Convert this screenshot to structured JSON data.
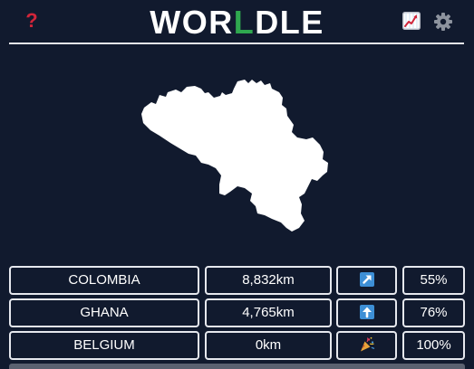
{
  "header": {
    "help_label": "?",
    "title_prefix": "WOR",
    "title_accent": "L",
    "title_suffix": "DLE"
  },
  "map": {
    "shape_icon": "belgium-silhouette",
    "fill_color": "#ffffff"
  },
  "colors": {
    "background": "#111a2e",
    "help": "#d1253a",
    "accent": "#2fa84f",
    "border": "#e6e8ee",
    "arrow_box": "#3d8fd6"
  },
  "guesses": [
    {
      "country": "COLOMBIA",
      "distance": "8,832km",
      "direction_icon": "arrow-up-right-icon",
      "percent": "55%"
    },
    {
      "country": "GHANA",
      "distance": "4,765km",
      "direction_icon": "arrow-up-icon",
      "percent": "76%"
    },
    {
      "country": "BELGIUM",
      "distance": "0km",
      "direction_icon": "party-popper-icon",
      "percent": "100%"
    }
  ]
}
